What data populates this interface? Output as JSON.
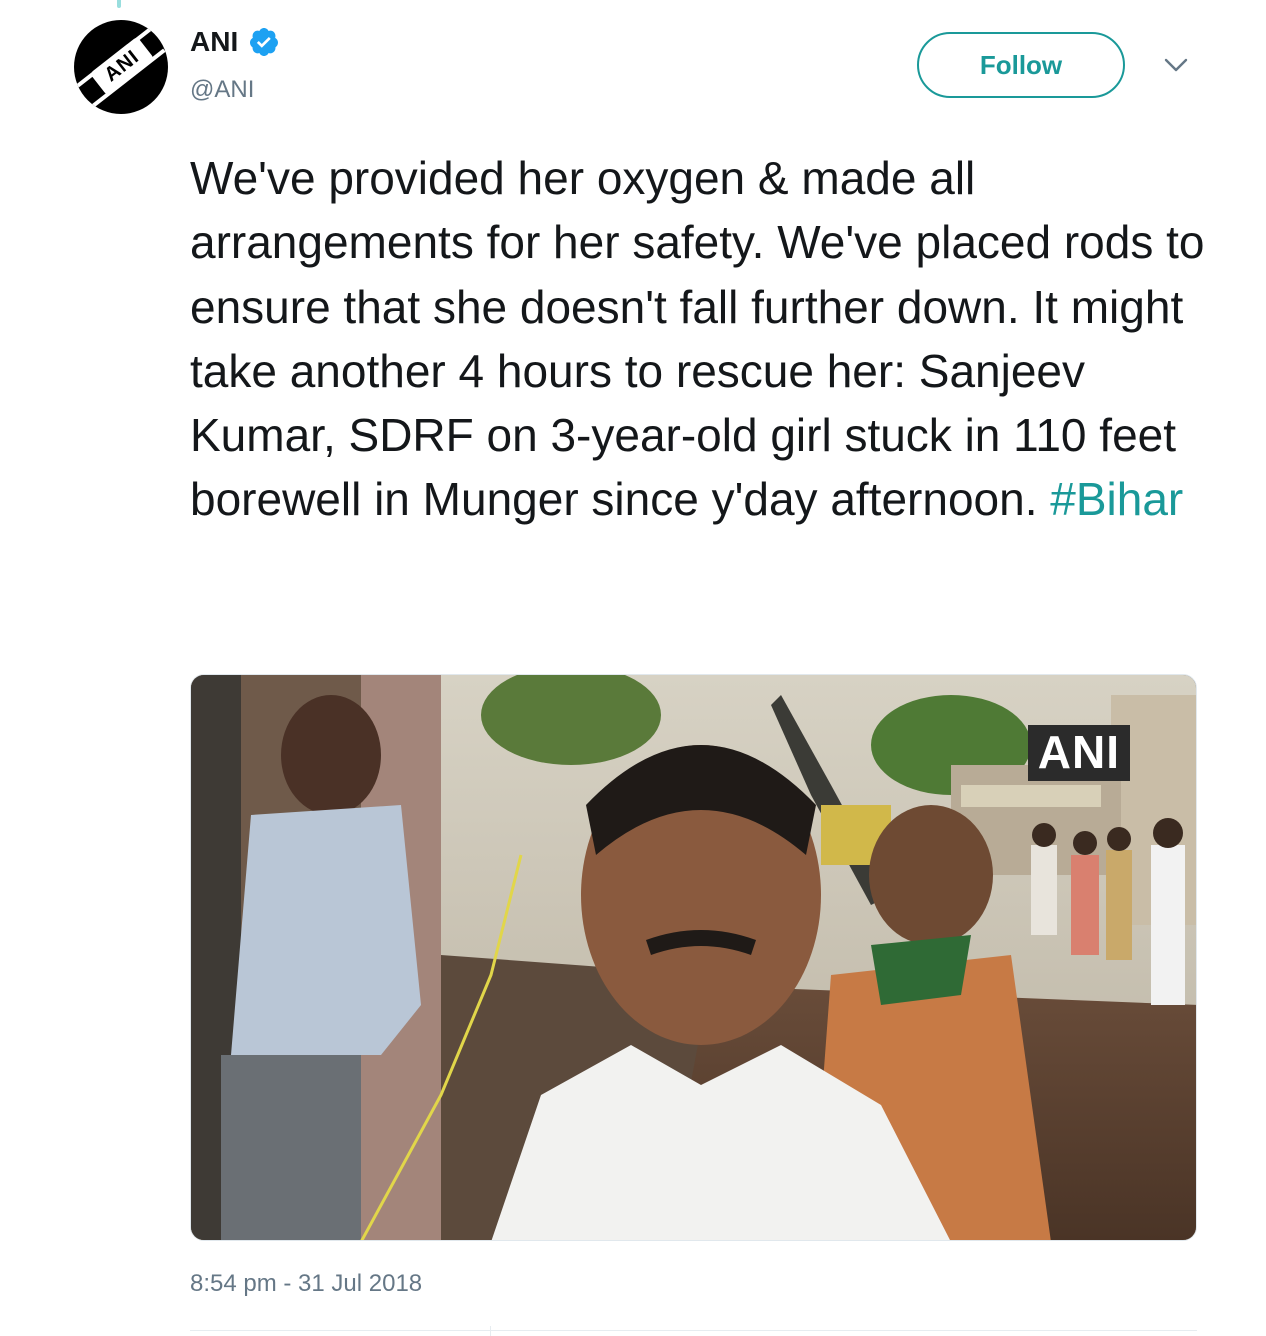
{
  "account": {
    "display_name": "ANI",
    "handle": "@ANI",
    "verified": true,
    "avatar_text": "ANI"
  },
  "actions": {
    "follow_label": "Follow",
    "more_icon": "chevron-down-icon"
  },
  "tweet": {
    "text": "We've provided her oxygen & made all arrangements for her safety. We've placed rods to ensure that she doesn't fall further down. It might take another 4 hours to rescue her: Sanjeev Kumar, SDRF on 3-year-old girl stuck in 110 feet borewell in Munger since y'day afternoon.",
    "hashtag": "#Bihar",
    "timestamp": "8:54 pm - 31 Jul 2018"
  },
  "media": {
    "watermark": "ANI"
  },
  "colors": {
    "accent": "#1a9999",
    "verified": "#1da1f2",
    "text": "#14171a",
    "secondary_text": "#657786"
  }
}
